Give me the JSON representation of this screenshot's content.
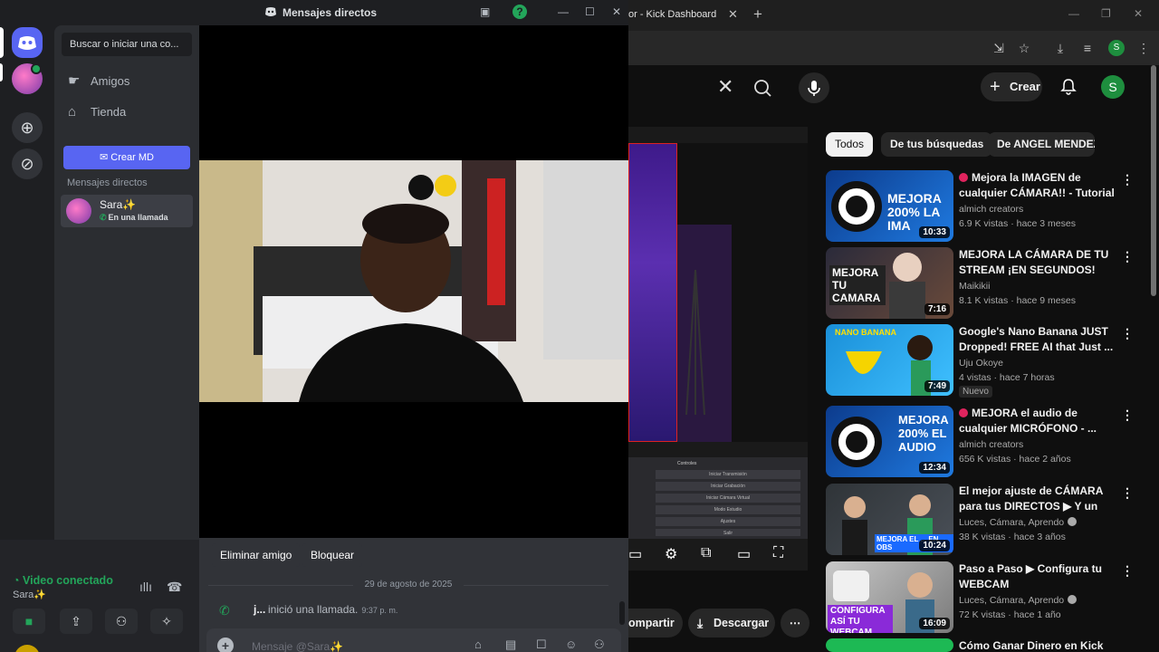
{
  "browser": {
    "tab_title": "or - Kick Dashboard",
    "youtube": {
      "create_label": "Crear",
      "avatar_letter": "S",
      "chips": [
        "Todos",
        "De tus búsquedas",
        "De ANGEL MENDEZ"
      ],
      "share_label": "ompartir",
      "download_label": "Descargar",
      "recommendations": [
        {
          "title": "Mejora la IMAGEN de cualquier CÁMARA!! - Tutorial ...",
          "channel": "almich creators",
          "meta": "6.9 K vistas · hace 3 meses",
          "duration": "10:33",
          "thumb_text": "MEJORA 200% LA IMA",
          "live_dot": true,
          "verified": false,
          "badge": ""
        },
        {
          "title": "MEJORA LA CÁMARA DE TU STREAM ¡EN SEGUNDOS!",
          "channel": "Maikikii",
          "meta": "8.1 K vistas · hace 9 meses",
          "duration": "7:16",
          "thumb_text": "MEJORA TU CAMARA",
          "live_dot": false,
          "verified": false,
          "badge": ""
        },
        {
          "title": "Google's Nano Banana JUST Dropped! FREE AI that Just ...",
          "channel": "Uju Okoye",
          "meta": "4 vistas · hace 7 horas",
          "duration": "7:49",
          "thumb_text": "NANO BANANA",
          "live_dot": false,
          "verified": false,
          "badge": "Nuevo"
        },
        {
          "title": "MEJORA el audio de cualquier MICRÓFONO - ...",
          "channel": "almich creators",
          "meta": "656 K vistas · hace 2 años",
          "duration": "12:34",
          "thumb_text": "MEJORA 200% EL AUDIO",
          "live_dot": true,
          "verified": false,
          "badge": ""
        },
        {
          "title": "El mejor ajuste de CÁMARA para tus DIRECTOS ▶ Y un LU...",
          "channel": "Luces, Cámara, Aprendo",
          "meta": "38 K vistas · hace 3 años",
          "duration": "10:24",
          "thumb_text": "MEJORA EL ... EN OBS",
          "live_dot": false,
          "verified": true,
          "badge": ""
        },
        {
          "title": "Paso a Paso ▶ Configura tu WEBCAM",
          "channel": "Luces, Cámara, Aprendo",
          "meta": "72 K vistas · hace 1 año",
          "duration": "16:09",
          "thumb_text": "CONFIGURA ASÍ TU WEBCAM",
          "live_dot": false,
          "verified": true,
          "badge": ""
        },
        {
          "title": "Cómo Ganar Dinero en Kick",
          "channel": "",
          "meta": "",
          "duration": "",
          "thumb_text": "",
          "live_dot": false,
          "verified": false,
          "badge": ""
        }
      ],
      "obs_rows": [
        "Iniciar Transmisión",
        "Iniciar Grabación",
        "Iniciar Cámara Virtual",
        "Modo Estudio",
        "Ajustes",
        "Salir"
      ],
      "obs_panel_title": "Controles"
    }
  },
  "discord": {
    "window_title": "Mensajes directos",
    "search_placeholder": "Buscar o iniciar una co...",
    "nav": {
      "friends": "Amigos",
      "store": "Tienda"
    },
    "create_dm": "Crear MD",
    "dm_header": "Mensajes directos",
    "dm": {
      "name": "Sara✨",
      "status": "En una llamada"
    },
    "voice": {
      "title": "Video conectado",
      "subtitle": "Sara✨"
    },
    "chat": {
      "remove_friend": "Eliminar amigo",
      "block": "Bloquear",
      "date": "29 de agosto de 2025",
      "call_user": "j...",
      "call_text": "inició una llamada.",
      "call_time": "9:37 p. m.",
      "composer_placeholder": "Mensaje @Sara✨"
    }
  },
  "colors": {
    "discord_blurple": "#5865f2",
    "discord_green": "#23a55a",
    "youtube_bg": "#0f0f0f"
  }
}
